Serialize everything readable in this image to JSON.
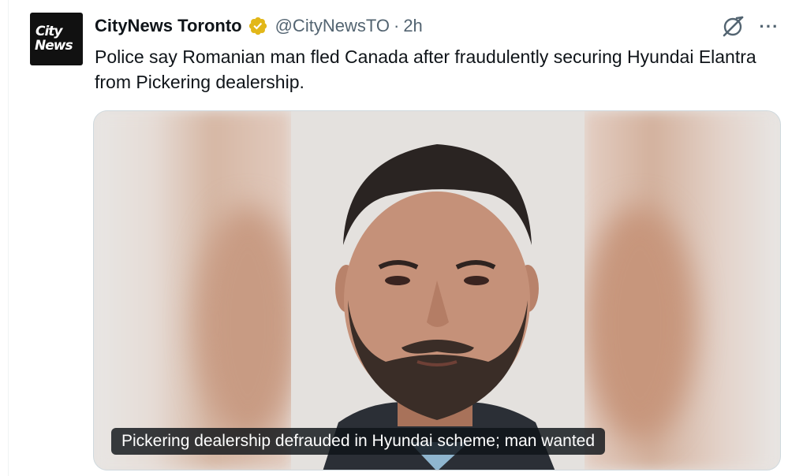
{
  "account": {
    "display_name": "CityNews Toronto",
    "handle": "@CityNewsTO",
    "separator": "·",
    "timestamp": "2h",
    "avatar_text_line1": "City",
    "avatar_text_line2": "News",
    "verified_color": "#e2b719"
  },
  "tweet": {
    "text": "Police say Romanian man fled Canada after fraudulently securing Hyundai Elantra from Pickering dealership."
  },
  "media": {
    "caption": "Pickering dealership defrauded in Hyundai scheme; man wanted"
  },
  "actions": {
    "grok_icon": "grok-icon",
    "more_icon": "more-options-icon",
    "more_label": "···"
  }
}
